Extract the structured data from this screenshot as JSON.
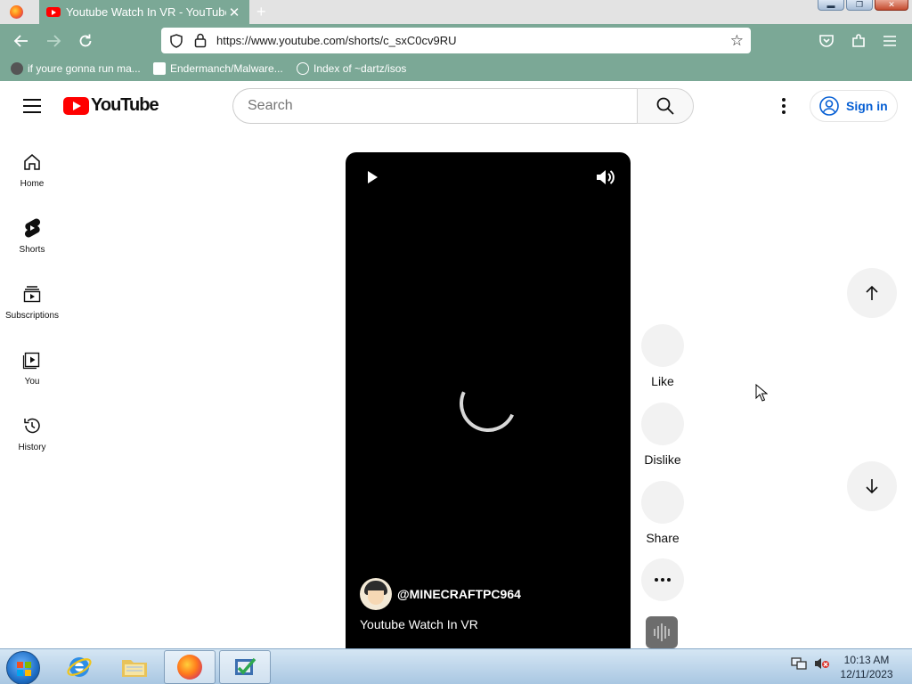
{
  "browser": {
    "tab_title": "Youtube Watch In VR - YouTube",
    "new_tab_label": "+",
    "url": "https://www.youtube.com/shorts/c_sxC0cv9RU",
    "bookmarks": [
      {
        "label": "if youre gonna run ma..."
      },
      {
        "label": "Endermanch/Malware..."
      },
      {
        "label": "Index of ~dartz/isos"
      }
    ],
    "accent_color": "#7ba896"
  },
  "youtube": {
    "logo_text": "YouTube",
    "search_placeholder": "Search",
    "signin_label": "Sign in",
    "sidebar": [
      {
        "label": "Home",
        "icon": "home-icon"
      },
      {
        "label": "Shorts",
        "icon": "shorts-icon"
      },
      {
        "label": "Subscriptions",
        "icon": "subscriptions-icon"
      },
      {
        "label": "You",
        "icon": "you-icon"
      },
      {
        "label": "History",
        "icon": "history-icon"
      }
    ],
    "short": {
      "channel": "@MINECRAFTPC964",
      "title": "Youtube Watch In VR"
    },
    "actions": {
      "like": "Like",
      "dislike": "Dislike",
      "share": "Share"
    }
  },
  "taskbar": {
    "time": "10:13 AM",
    "date": "12/11/2023"
  }
}
